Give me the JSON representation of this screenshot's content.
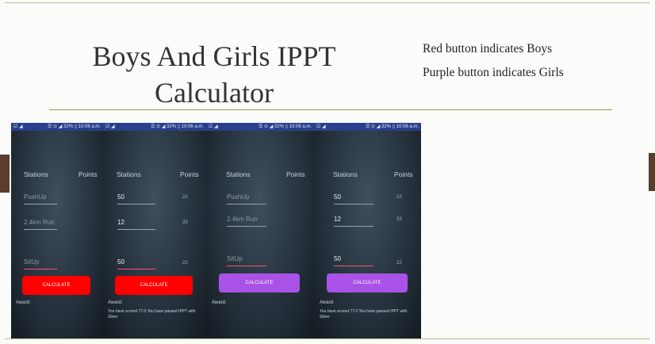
{
  "slide": {
    "title_line1": "Boys And Girls IPPT",
    "title_line2": "Calculator",
    "note1": "Red button indicates Boys",
    "note2": "Purple button indicates Girls"
  },
  "status": {
    "left": "☑ ◢",
    "right": "☰ ⊙ ◢ 32% ▯ 10:06 a.m."
  },
  "labels": {
    "stations": "Stations",
    "points": "Points",
    "award": "Award:",
    "calculate": "CALCULATE"
  },
  "phones": [
    {
      "gender": "Boys",
      "button_color": "#ff0000",
      "pushup": "PushUp",
      "run": "2.4km Run",
      "situp": "SitUp",
      "pushup_pts": "",
      "run_pts": "",
      "situp_pts": "",
      "result": ""
    },
    {
      "gender": "Boys",
      "button_color": "#ff0000",
      "pushup": "50",
      "run": "12",
      "situp": "50",
      "pushup_pts": "22",
      "run_pts": "33",
      "situp_pts": "22",
      "result": "You have scored  77.0  You have passed IPPT with Silver"
    },
    {
      "gender": "Girls",
      "button_color": "#a952e8",
      "pushup": "PushUp",
      "run": "2.4km Run",
      "situp": "SitUp",
      "pushup_pts": "",
      "run_pts": "",
      "situp_pts": "",
      "result": ""
    },
    {
      "gender": "Girls",
      "button_color": "#a952e8",
      "pushup": "50",
      "run": "12",
      "situp": "50",
      "pushup_pts": "22",
      "run_pts": "33",
      "situp_pts": "22",
      "result": "You have scored  77.0  You have passed IPPT with Silver"
    }
  ]
}
